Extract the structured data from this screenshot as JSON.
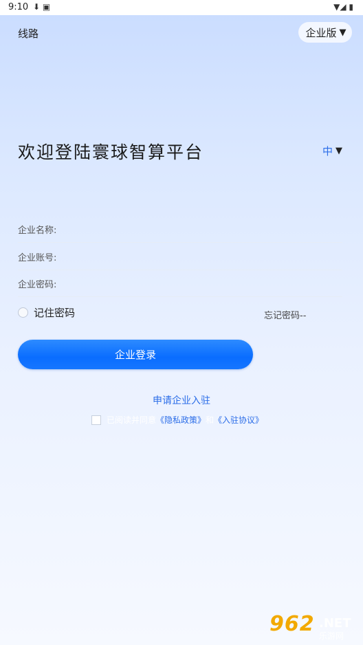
{
  "status": {
    "time": "9:10",
    "left_icons": "⬇ ▣",
    "right_icons": "▼◢ ▮"
  },
  "header": {
    "route_label": "线路",
    "edition": "企业版"
  },
  "title": "欢迎登陆寰球智算平台",
  "language": "中",
  "form": {
    "company_name_label": "企业名称:",
    "account_label": "企业账号:",
    "password_label": "企业密码:"
  },
  "remember_label": "记住密码",
  "forgot_label": "忘记密码--",
  "login_button": "企业登录",
  "apply_link": "申请企业入驻",
  "agreement": {
    "prefix": "已阅读并同意",
    "privacy": "《隐私政策》",
    "and": "和",
    "terms": "《入驻协议》"
  },
  "watermark": {
    "number": "962",
    "net": ".NET",
    "site": "乐游网"
  },
  "colors": {
    "accent": "#2b6de8",
    "button": "#0a6dff"
  }
}
